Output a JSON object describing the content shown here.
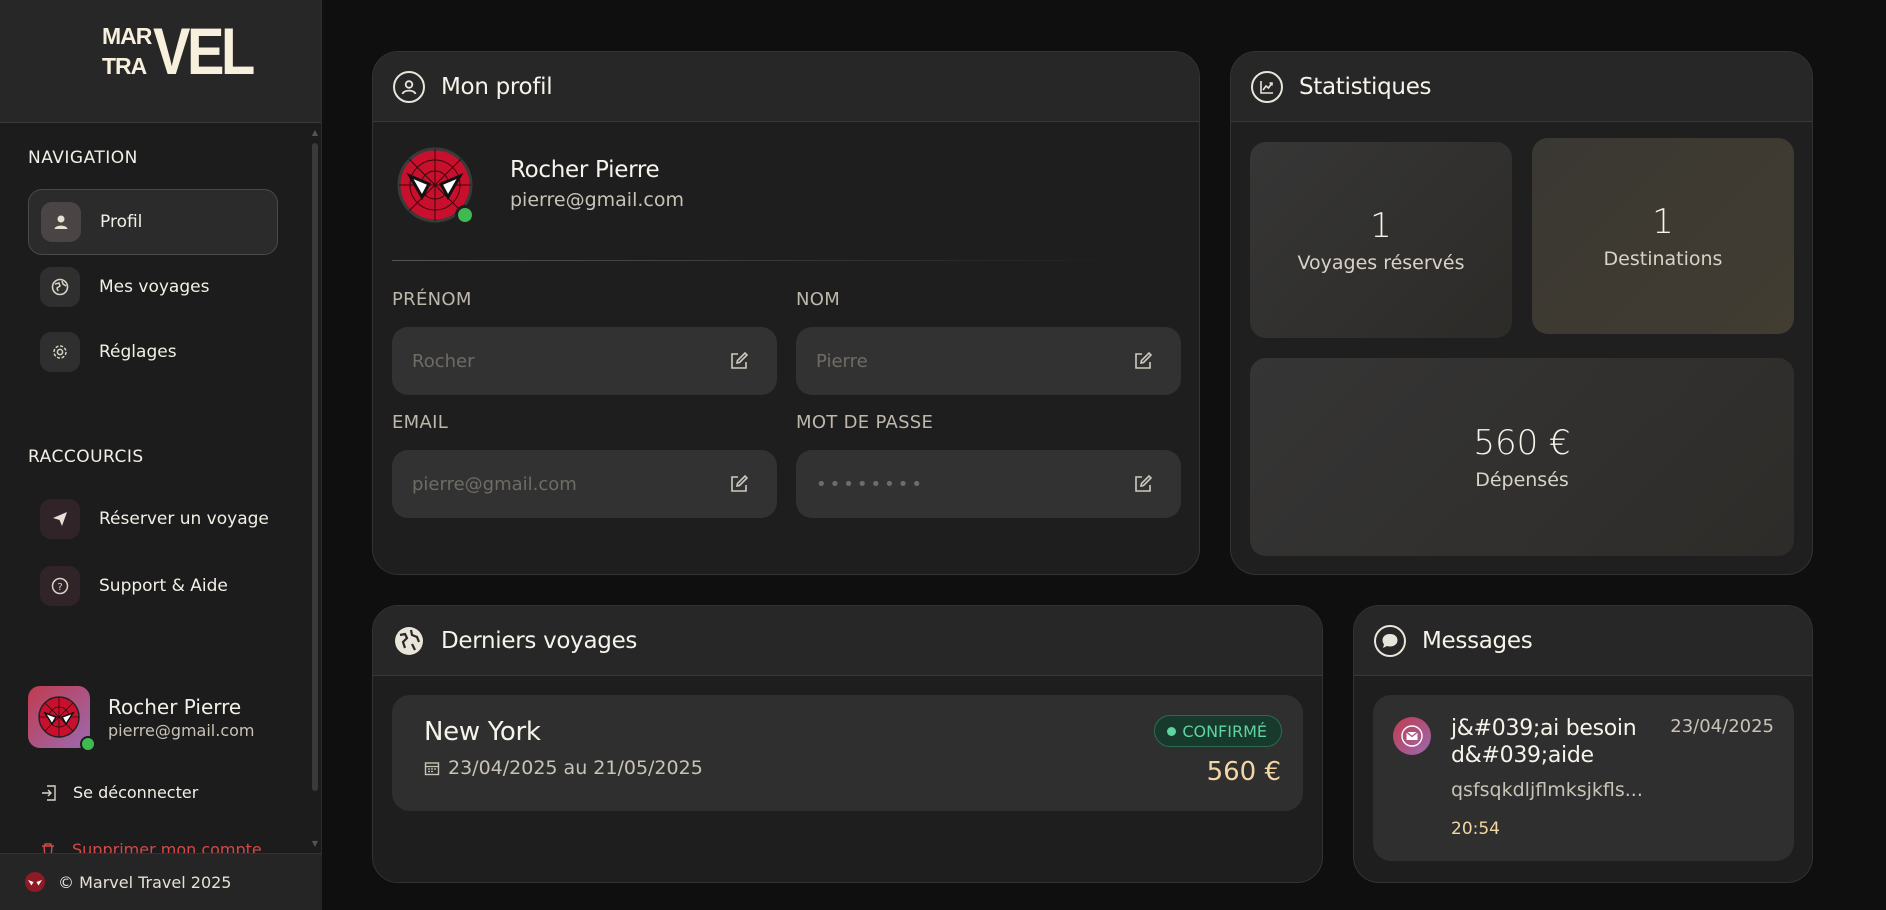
{
  "brand": {
    "logo_top": "MAR",
    "logo_bottom": "TRA",
    "logo_big": "VEL"
  },
  "sidebar": {
    "nav_title": "NAVIGATION",
    "nav_items": [
      {
        "label": "Profil",
        "icon": "user-icon",
        "active": true
      },
      {
        "label": "Mes voyages",
        "icon": "globe-icon",
        "active": false
      },
      {
        "label": "Réglages",
        "icon": "gear-icon",
        "active": false
      }
    ],
    "shortcuts_title": "RACCOURCIS",
    "shortcuts": [
      {
        "label": "Réserver un voyage",
        "icon": "send-icon"
      },
      {
        "label": "Support & Aide",
        "icon": "help-icon"
      }
    ],
    "user": {
      "name": "Rocher Pierre",
      "email": "pierre@gmail.com"
    },
    "logout_label": "Se déconnecter",
    "delete_label": "Supprimer mon compte",
    "footer": "© Marvel Travel 2025"
  },
  "profile": {
    "title": "Mon profil",
    "name": "Rocher Pierre",
    "email": "pierre@gmail.com",
    "fields": {
      "firstname_label": "PRÉNOM",
      "firstname_placeholder": "Rocher",
      "lastname_label": "NOM",
      "lastname_placeholder": "Pierre",
      "email_label": "EMAIL",
      "email_placeholder": "pierre@gmail.com",
      "password_label": "MOT DE PASSE",
      "password_placeholder": "••••••••"
    }
  },
  "stats": {
    "title": "Statistiques",
    "trips_value": "1",
    "trips_label": "Voyages réservés",
    "dest_value": "1",
    "dest_label": "Destinations",
    "spent_value": "560 €",
    "spent_label": "Dépensés"
  },
  "trips": {
    "title": "Derniers voyages",
    "items": [
      {
        "city": "New York",
        "dates": "23/04/2025 au 21/05/2025",
        "status": "CONFIRMÉ",
        "price": "560 €"
      }
    ]
  },
  "messages": {
    "title": "Messages",
    "items": [
      {
        "subject": "j&#039;ai besoin d&#039;aide",
        "date": "23/04/2025",
        "preview": "qsfsqkdljflmksjkfls...",
        "time": "20:54"
      }
    ]
  },
  "colors": {
    "accent_gold": "#f3d6a4",
    "confirm_green": "#5fd3a1",
    "online": "#3fb950",
    "danger": "#d24a4a"
  }
}
